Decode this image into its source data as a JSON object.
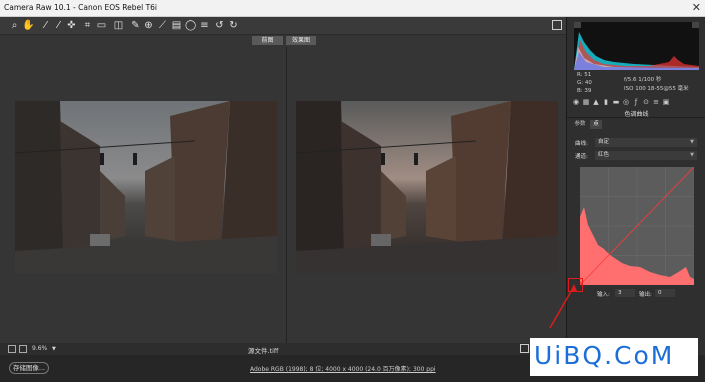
{
  "window": {
    "title": "Camera Raw 10.1 -  Canon EOS Rebel T6i",
    "close": "✕"
  },
  "toolbar": {
    "tools": [
      "zoom-tool-icon",
      "hand-tool-icon",
      "white-balance-icon",
      "color-sampler-icon",
      "targeted-adjust-icon",
      "crop-icon",
      "straighten-icon",
      "transform-icon",
      "spot-removal-icon",
      "red-eye-icon",
      "adjustment-brush-icon",
      "graduated-filter-icon",
      "radial-filter-icon",
      "prefs-icon",
      "rotate-ccw-icon",
      "rotate-cw-icon"
    ]
  },
  "view": {
    "before_label": "前图",
    "after_label": "效果图"
  },
  "status": {
    "zoom": "9.6%",
    "source_file": "源文件.tiff"
  },
  "bottom": {
    "save_label": "存储图像...",
    "workflow": "Adobe RGB (1998); 8 位; 4000 x 4000 (24.0 百万像素); 300 ppi"
  },
  "readout": {
    "r": "R:  51",
    "g": "G:  40",
    "b": "B:  39",
    "exposure": "f/5.6   1/100 秒",
    "iso": "ISO 100   18-55@55 毫米"
  },
  "panel": {
    "section_title": "色调曲线",
    "tab_parametric": "参数",
    "tab_point": "点",
    "curve_label": "曲线:",
    "curve_value": "自定",
    "channel_label": "通道:",
    "channel_value": "红色",
    "input_label": "输入:",
    "input_value": "3",
    "output_label": "输出:",
    "output_value": "0"
  },
  "colors": {
    "accent": "#e01b1b",
    "curve_fill": "#ff6f6f",
    "watermark": "#1c6fd8"
  },
  "watermark": {
    "text": "UiBQ.CoM"
  }
}
